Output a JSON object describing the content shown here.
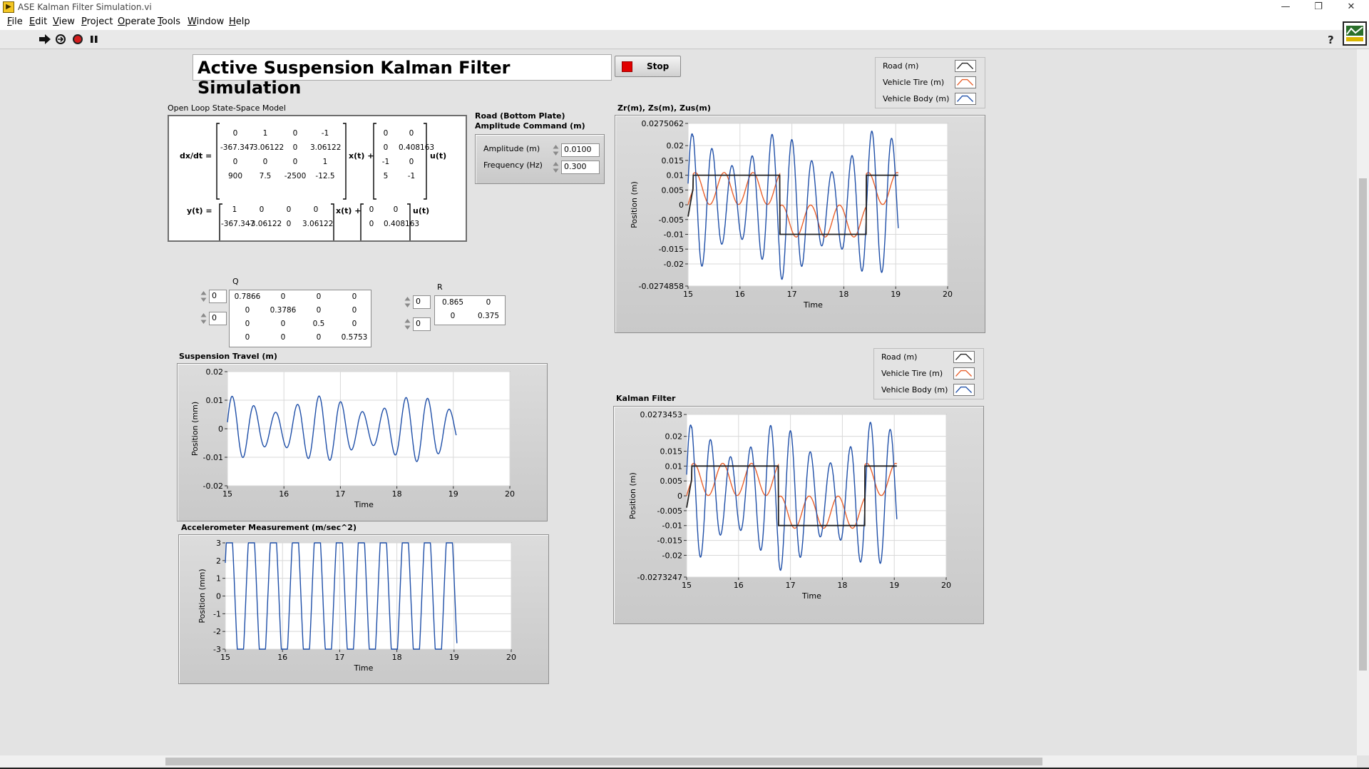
{
  "window": {
    "title": "ASE Kalman Filter Simulation.vi",
    "minimize": "—",
    "restore": "❐",
    "close": "✕"
  },
  "menu": [
    "File",
    "Edit",
    "View",
    "Project",
    "Operate",
    "Tools",
    "Window",
    "Help"
  ],
  "toolbar": {
    "help": "?"
  },
  "panel": {
    "title": "Active Suspension Kalman Filter Simulation",
    "stop_label": "Stop",
    "state_space": {
      "label": "Open Loop State-Space Model",
      "dx_label": "dx/dt =",
      "x_label": "x(t) +",
      "u_label": "u(t)",
      "y_label": "y(t) =",
      "A": [
        [
          "0",
          "1",
          "0",
          "-1"
        ],
        [
          "-367.347",
          "-3.06122",
          "0",
          "3.06122"
        ],
        [
          "0",
          "0",
          "0",
          "1"
        ],
        [
          "900",
          "7.5",
          "-2500",
          "-12.5"
        ]
      ],
      "B": [
        [
          "0",
          "0"
        ],
        [
          "0",
          "0.408163"
        ],
        [
          "-1",
          "0"
        ],
        [
          "5",
          "-1"
        ]
      ],
      "C": [
        [
          "1",
          "0",
          "0",
          "0"
        ],
        [
          "-367.347",
          "-3.06122",
          "0",
          "3.06122"
        ]
      ],
      "D": [
        [
          "0",
          "0"
        ],
        [
          "0",
          "0.408163"
        ]
      ]
    },
    "road": {
      "label_line1": "Road (Bottom Plate)",
      "label_line2": "Amplitude Command (m)",
      "amplitude_label": "Amplitude (m)",
      "amplitude_value": "0.0100",
      "frequency_label": "Frequency (Hz)",
      "frequency_value": "0.300"
    },
    "Q": {
      "label": "Q",
      "index_row": "0",
      "index_col": "0",
      "values": [
        [
          "0.7866",
          "0",
          "0",
          "0"
        ],
        [
          "0",
          "0.3786",
          "0",
          "0"
        ],
        [
          "0",
          "0",
          "0.5",
          "0"
        ],
        [
          "0",
          "0",
          "0",
          "0.5753"
        ]
      ]
    },
    "R": {
      "label": "R",
      "index_row": "0",
      "index_col": "0",
      "values": [
        [
          "0.865",
          "0"
        ],
        [
          "0",
          "0.375"
        ]
      ]
    },
    "legend_top": [
      "Road (m)",
      "Vehicle Tire (m)",
      "Vehicle Body (m)"
    ],
    "legend_bottom": [
      "Road (m)",
      "Vehicle Tire (m)",
      "Vehicle Body (m)"
    ]
  },
  "colors": {
    "road": "#222222",
    "tire": "#e8602c",
    "body": "#1f4fa8",
    "trace": "#1f4fa8",
    "stop_led": "#e10000"
  },
  "chart_data": [
    {
      "id": "response",
      "type": "line",
      "title": "Zr(m), Zs(m), Zus(m)",
      "xlabel": "Time",
      "ylabel": "Position (m)",
      "xlim": [
        15,
        20
      ],
      "ylim": [
        -0.0274858,
        0.0275062
      ],
      "xticks": [
        "15",
        "16",
        "17",
        "18",
        "19",
        "20"
      ],
      "yticks": [
        "0.0275062",
        "0.02",
        "0.015",
        "0.01",
        "0.005",
        "0",
        "-0.005",
        "-0.01",
        "-0.015",
        "-0.02",
        "-0.0274858"
      ],
      "series": [
        {
          "name": "Road (m)",
          "model": "road",
          "amplitude": 0.01,
          "phase_start": 15.1,
          "x_end": 19.05
        },
        {
          "name": "Vehicle Tire (m)",
          "model": "tire",
          "amplitude": 0.006,
          "freq_hz": 1.8,
          "x_end": 19.05
        },
        {
          "name": "Vehicle Body (m)",
          "model": "body",
          "amplitude": 0.0275,
          "freq_hz": 2.6,
          "x_end": 19.05
        }
      ],
      "grid": true
    },
    {
      "id": "kalman",
      "type": "line",
      "title": "Kalman Filter",
      "xlabel": "Time",
      "ylabel": "Position (m)",
      "xlim": [
        15,
        20
      ],
      "ylim": [
        -0.0273247,
        0.0273453
      ],
      "xticks": [
        "15",
        "16",
        "17",
        "18",
        "19",
        "20"
      ],
      "yticks": [
        "0.0273453",
        "0.02",
        "0.015",
        "0.01",
        "0.005",
        "0",
        "-0.005",
        "-0.01",
        "-0.015",
        "-0.02",
        "-0.0273247"
      ],
      "series": [
        {
          "name": "Road (m)",
          "model": "road",
          "amplitude": 0.01,
          "phase_start": 15.1,
          "x_end": 19.05
        },
        {
          "name": "Vehicle Tire (m)",
          "model": "tire",
          "amplitude": 0.006,
          "freq_hz": 1.8,
          "x_end": 19.05
        },
        {
          "name": "Vehicle Body (m)",
          "model": "body",
          "amplitude": 0.0273,
          "freq_hz": 2.6,
          "x_end": 19.05
        }
      ],
      "grid": true
    },
    {
      "id": "suspension",
      "type": "line",
      "title": "Suspension Travel (m)",
      "xlabel": "Time",
      "ylabel": "Position (mm)",
      "xlim": [
        15,
        20
      ],
      "ylim": [
        -0.02,
        0.02
      ],
      "xticks": [
        "15",
        "16",
        "17",
        "18",
        "19",
        "20"
      ],
      "yticks": [
        "0.02",
        "0.01",
        "0",
        "-0.01",
        "-0.02"
      ],
      "series": [
        {
          "model": "travel",
          "amplitude": 0.0115,
          "freq_hz": 2.6,
          "x_end": 19.05
        }
      ],
      "grid": true
    },
    {
      "id": "accel",
      "type": "line",
      "title": "Accelerometer Measurement (m/sec^2)",
      "xlabel": "Time",
      "ylabel": "Position (mm)",
      "xlim": [
        15,
        20
      ],
      "ylim": [
        -3,
        3
      ],
      "xticks": [
        "15",
        "16",
        "17",
        "18",
        "19",
        "20"
      ],
      "yticks": [
        "3",
        "2",
        "1",
        "0",
        "-1",
        "-2",
        "-3"
      ],
      "series": [
        {
          "model": "accel",
          "amplitude": 3.0,
          "freq_hz": 2.6,
          "x_end": 19.05
        }
      ],
      "grid": true
    }
  ]
}
